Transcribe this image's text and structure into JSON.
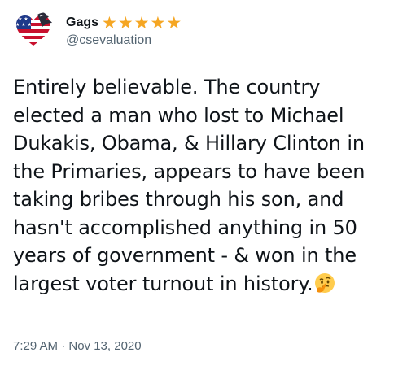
{
  "user": {
    "display_name": "Gags",
    "rating_stars": "★★★★★",
    "handle": "@csevaluation",
    "avatar_icon": "american-flag-eagle-heart-icon"
  },
  "tweet": {
    "text": "Entirely believable. The country elected a man who lost to Michael Dukakis, Obama, & Hillary Clinton in the Primaries, appears to have been taking bribes through his son, and hasn't accomplished anything in 50 years of government - & won in the largest voter turnout in history.",
    "emoji": "thinking-face-icon",
    "timestamp": "7:29 AM · Nov 13, 2020"
  },
  "colors": {
    "text": "#0f1419",
    "secondary": "#536471",
    "star": "#f5a623",
    "flag_red": "#c8102e",
    "flag_blue": "#1f3a8a"
  }
}
